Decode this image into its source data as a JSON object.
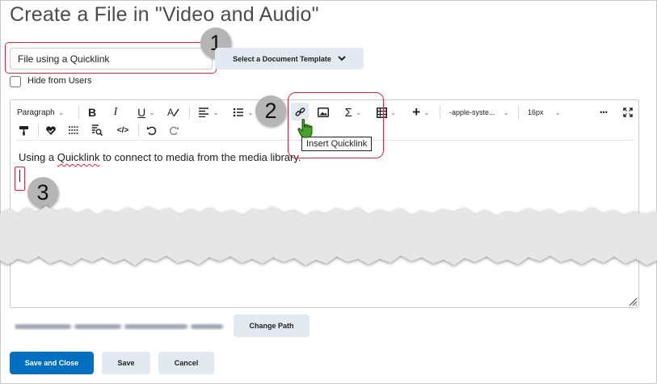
{
  "page": {
    "title": "Create a File in \"Video and Audio\""
  },
  "form": {
    "title_value": "File using a Quicklink",
    "template_button": "Select a Document Template",
    "hide_from_users_label": "Hide from Users",
    "hide_from_users_checked": false
  },
  "toolbar": {
    "paragraph_format": "Paragraph",
    "bold": "B",
    "italic": "I",
    "underline": "U",
    "font_family": "-apple-syste...",
    "font_size": "16px",
    "more": "•••",
    "insert_quicklink_tooltip": "Insert Quicklink"
  },
  "editor": {
    "content_before": "Using a ",
    "content_link_word": "Quicklink",
    "content_after": " to connect to media from the media library."
  },
  "footer": {
    "change_path_button": "Change Path",
    "save_and_close_button": "Save and Close",
    "save_button": "Save",
    "cancel_button": "Cancel"
  },
  "callouts": [
    "1",
    "2",
    "3"
  ],
  "colors": {
    "primary": "#006fbf",
    "secondary_button": "#e3e9f1",
    "highlight_red": "#d9263b",
    "callout_grey": "#b5b5b5",
    "cursor_green": "#46a12b"
  }
}
